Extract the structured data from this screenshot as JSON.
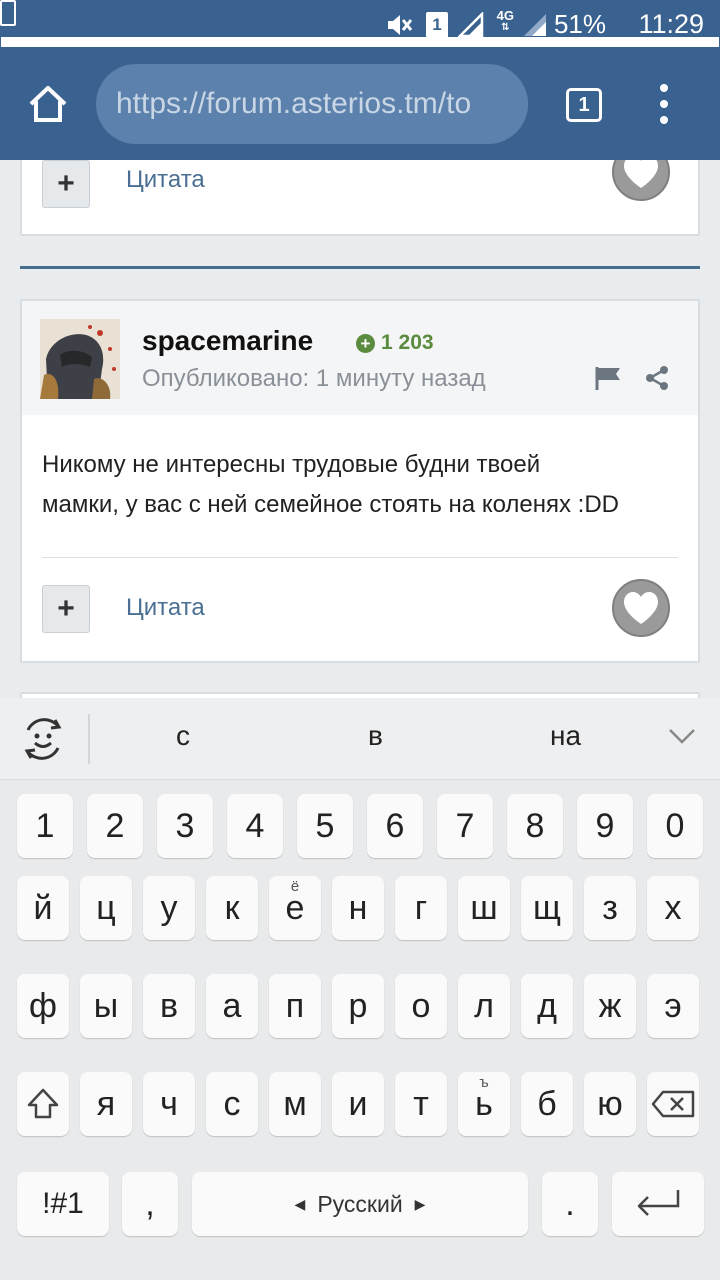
{
  "status_bar": {
    "sim_label": "1",
    "network": "4G",
    "battery": "51%",
    "time": "11:29"
  },
  "toolbar": {
    "url": "https://forum.asterios.tm/to",
    "tab_count": "1"
  },
  "prev_post": {
    "quote_label": "Цитата"
  },
  "post": {
    "author": "spacemarine",
    "reputation": "1 203",
    "posted": "Опубликовано: 1 минуту назад",
    "body_line1": "Никому не интересны трудовые будни твоей",
    "body_line2": "мамки, у вас с ней семейное стоять на коленях :DD",
    "quote_label": "Цитата"
  },
  "keyboard": {
    "suggestions": [
      "с",
      "в",
      "на"
    ],
    "row_digits": [
      "1",
      "2",
      "3",
      "4",
      "5",
      "6",
      "7",
      "8",
      "9",
      "0"
    ],
    "row1": [
      "й",
      "ц",
      "у",
      "к",
      "е",
      "н",
      "г",
      "ш",
      "щ",
      "з",
      "х"
    ],
    "row1_alt_e": "ё",
    "row2": [
      "ф",
      "ы",
      "в",
      "а",
      "п",
      "р",
      "о",
      "л",
      "д",
      "ж",
      "э"
    ],
    "row3": [
      "я",
      "ч",
      "с",
      "м",
      "и",
      "т",
      "ь",
      "б",
      "ю"
    ],
    "row3_alt_soft": "ъ",
    "symbols_label": "!#1",
    "comma": ",",
    "space_label": "Русский",
    "period": "."
  }
}
